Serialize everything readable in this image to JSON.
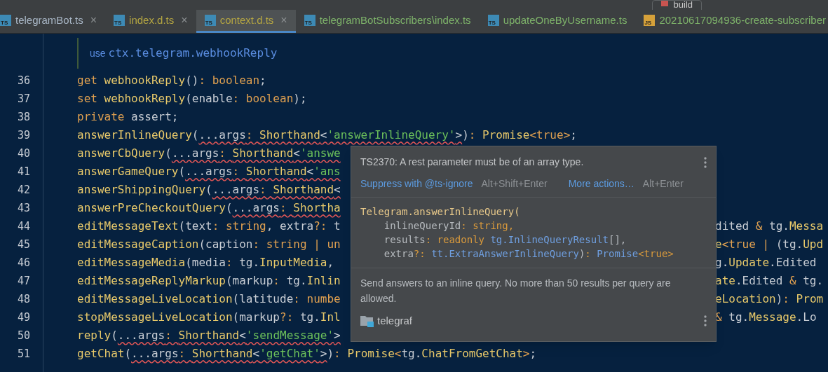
{
  "toolbar": {
    "run_config": "build"
  },
  "tabs": [
    {
      "icon_label": "TS",
      "label": "telegramBot.ts",
      "color": "#a9b7c6",
      "selected": false,
      "close": "×"
    },
    {
      "icon_label": "TS",
      "label": "index.d.ts",
      "color": "#b5a642",
      "selected": false,
      "close": "×"
    },
    {
      "icon_label": "TS",
      "label": "context.d.ts",
      "color": "#b5a642",
      "selected": true,
      "close": "×"
    },
    {
      "icon_label": "TS",
      "label": "telegramBotSubscribers\\index.ts",
      "color": "#7eb36a",
      "selected": false
    },
    {
      "icon_label": "TS",
      "label": "updateOneByUsername.ts",
      "color": "#7eb36a",
      "selected": false
    },
    {
      "icon_label": "JS",
      "label": "20210617094936-create-subscriber",
      "color": "#7eb36a",
      "selected": false
    }
  ],
  "doc_comment": {
    "prefix": "use",
    "code": "ctx.telegram.webhookReply"
  },
  "code_lines": [
    {
      "number": "36",
      "tokens": [
        {
          "text": "get ",
          "kind": "kw",
          "error": false
        },
        {
          "text": "webhookReply",
          "kind": "fn",
          "error": false
        },
        {
          "text": "()",
          "kind": "plain",
          "error": false
        },
        {
          "text": ": boolean",
          "kind": "kw",
          "error": false
        },
        {
          "text": ";",
          "kind": "plain",
          "error": false
        }
      ]
    },
    {
      "number": "37",
      "tokens": [
        {
          "text": "set ",
          "kind": "kw",
          "error": false
        },
        {
          "text": "webhookReply",
          "kind": "fn",
          "error": false
        },
        {
          "text": "(enable",
          "kind": "plain",
          "error": false
        },
        {
          "text": ": boolean",
          "kind": "kw",
          "error": false
        },
        {
          "text": ");",
          "kind": "plain",
          "error": false
        }
      ]
    },
    {
      "number": "38",
      "tokens": [
        {
          "text": "private ",
          "kind": "kw",
          "error": false
        },
        {
          "text": "assert;",
          "kind": "plain",
          "error": false
        }
      ]
    },
    {
      "number": "39",
      "tokens": [
        {
          "text": "answerInlineQuery",
          "kind": "fn",
          "error": false
        },
        {
          "text": "(",
          "kind": "plain",
          "error": false
        },
        {
          "text": "...args",
          "kind": "plain",
          "error": true
        },
        {
          "text": ": ",
          "kind": "kw",
          "error": true
        },
        {
          "text": "Shorthand",
          "kind": "type",
          "error": true
        },
        {
          "text": "<",
          "kind": "plain",
          "error": true
        },
        {
          "text": "'answerInlineQuery'",
          "kind": "str",
          "error": true
        },
        {
          "text": ">",
          "kind": "plain",
          "error": true
        },
        {
          "text": ")",
          "kind": "plain",
          "error": false
        },
        {
          "text": ": ",
          "kind": "kw",
          "error": false
        },
        {
          "text": "Promise",
          "kind": "type",
          "error": false
        },
        {
          "text": "<true>",
          "kind": "kw",
          "error": false
        },
        {
          "text": ";",
          "kind": "plain",
          "error": false
        }
      ]
    },
    {
      "number": "40",
      "tokens": [
        {
          "text": "answerCbQuery",
          "kind": "fn",
          "error": false
        },
        {
          "text": "(",
          "kind": "plain",
          "error": false
        },
        {
          "text": "...args",
          "kind": "plain",
          "error": true
        },
        {
          "text": ": ",
          "kind": "kw",
          "error": true
        },
        {
          "text": "Shorthand",
          "kind": "type",
          "error": true
        },
        {
          "text": "<",
          "kind": "plain",
          "error": true
        },
        {
          "text": "'answe",
          "kind": "str",
          "error": true
        }
      ]
    },
    {
      "number": "41",
      "tokens": [
        {
          "text": "answerGameQuery",
          "kind": "fn",
          "error": false
        },
        {
          "text": "(",
          "kind": "plain",
          "error": false
        },
        {
          "text": "...args",
          "kind": "plain",
          "error": true
        },
        {
          "text": ": ",
          "kind": "kw",
          "error": true
        },
        {
          "text": "Shorthand",
          "kind": "type",
          "error": true
        },
        {
          "text": "<",
          "kind": "plain",
          "error": true
        },
        {
          "text": "'ans",
          "kind": "str",
          "error": true
        }
      ]
    },
    {
      "number": "42",
      "tokens": [
        {
          "text": "answerShippingQuery",
          "kind": "fn",
          "error": false
        },
        {
          "text": "(",
          "kind": "plain",
          "error": false
        },
        {
          "text": "...args",
          "kind": "plain",
          "error": true
        },
        {
          "text": ": ",
          "kind": "kw",
          "error": true
        },
        {
          "text": "Shorthand",
          "kind": "type",
          "error": true
        },
        {
          "text": "<",
          "kind": "plain",
          "error": true
        }
      ]
    },
    {
      "number": "43",
      "tokens": [
        {
          "text": "answerPreCheckoutQuery",
          "kind": "fn",
          "error": false
        },
        {
          "text": "(",
          "kind": "plain",
          "error": false
        },
        {
          "text": "...args",
          "kind": "plain",
          "error": true
        },
        {
          "text": ": ",
          "kind": "kw",
          "error": true
        },
        {
          "text": "Shortha",
          "kind": "type",
          "error": true
        }
      ]
    },
    {
      "number": "44",
      "tokens": [
        {
          "text": "editMessageText",
          "kind": "fn",
          "error": false
        },
        {
          "text": "(text",
          "kind": "plain",
          "error": false
        },
        {
          "text": ": string",
          "kind": "kw",
          "error": false
        },
        {
          "text": ", extra",
          "kind": "plain",
          "error": false
        },
        {
          "text": "?: ",
          "kind": "kw",
          "error": false
        },
        {
          "text": "t",
          "kind": "plain",
          "error": false
        }
      ],
      "tail": [
        {
          "text": "dited ",
          "kind": "plain",
          "error": false
        },
        {
          "text": "& ",
          "kind": "kw",
          "error": false
        },
        {
          "text": "tg.",
          "kind": "plain",
          "error": false
        },
        {
          "text": "Messa",
          "kind": "type",
          "error": false
        }
      ]
    },
    {
      "number": "45",
      "tokens": [
        {
          "text": "editMessageCaption",
          "kind": "fn",
          "error": false
        },
        {
          "text": "(caption",
          "kind": "plain",
          "error": false
        },
        {
          "text": ": string | un",
          "kind": "kw",
          "error": false
        }
      ],
      "tail": [
        {
          "text": "e",
          "kind": "type",
          "error": false
        },
        {
          "text": "<true | ",
          "kind": "kw",
          "error": false
        },
        {
          "text": "(tg.",
          "kind": "plain",
          "error": false
        },
        {
          "text": "Upd",
          "kind": "type",
          "error": false
        }
      ]
    },
    {
      "number": "46",
      "tokens": [
        {
          "text": "editMessageMedia",
          "kind": "fn",
          "error": false
        },
        {
          "text": "(media",
          "kind": "plain",
          "error": false
        },
        {
          "text": ": ",
          "kind": "kw",
          "error": false
        },
        {
          "text": "tg.",
          "kind": "plain",
          "error": false
        },
        {
          "text": "InputMedia",
          "kind": "type",
          "error": false
        },
        {
          "text": ",",
          "kind": "plain",
          "error": false
        }
      ],
      "tail": [
        {
          "text": "g.",
          "kind": "plain",
          "error": false
        },
        {
          "text": "Update",
          "kind": "type",
          "error": false
        },
        {
          "text": ".Edited",
          "kind": "plain",
          "error": false
        }
      ]
    },
    {
      "number": "47",
      "tokens": [
        {
          "text": "editMessageReplyMarkup",
          "kind": "fn",
          "error": false
        },
        {
          "text": "(markup",
          "kind": "plain",
          "error": false
        },
        {
          "text": ": ",
          "kind": "kw",
          "error": false
        },
        {
          "text": "tg.",
          "kind": "plain",
          "error": false
        },
        {
          "text": "Inlin",
          "kind": "type",
          "error": false
        }
      ],
      "tail": [
        {
          "text": "ate",
          "kind": "type",
          "error": false
        },
        {
          "text": ".Edited ",
          "kind": "plain",
          "error": false
        },
        {
          "text": "& ",
          "kind": "kw",
          "error": false
        },
        {
          "text": "tg.",
          "kind": "plain",
          "error": false
        }
      ]
    },
    {
      "number": "48",
      "tokens": [
        {
          "text": "editMessageLiveLocation",
          "kind": "fn",
          "error": false
        },
        {
          "text": "(latitude",
          "kind": "plain",
          "error": false
        },
        {
          "text": ": numbe",
          "kind": "kw",
          "error": false
        }
      ],
      "tail": [
        {
          "text": "eLocation",
          "kind": "type",
          "error": false
        },
        {
          "text": ")",
          "kind": "plain",
          "error": false
        },
        {
          "text": ": ",
          "kind": "kw",
          "error": false
        },
        {
          "text": "Prom",
          "kind": "type",
          "error": false
        }
      ]
    },
    {
      "number": "49",
      "tokens": [
        {
          "text": "stopMessageLiveLocation",
          "kind": "fn",
          "error": false
        },
        {
          "text": "(markup",
          "kind": "plain",
          "error": false
        },
        {
          "text": "?: ",
          "kind": "kw",
          "error": false
        },
        {
          "text": "tg.",
          "kind": "plain",
          "error": false
        },
        {
          "text": "Inl",
          "kind": "type",
          "error": false
        }
      ],
      "tail": [
        {
          "text": "& ",
          "kind": "kw",
          "error": false
        },
        {
          "text": "tg.",
          "kind": "plain",
          "error": false
        },
        {
          "text": "Message",
          "kind": "type",
          "error": false
        },
        {
          "text": ".Lo",
          "kind": "plain",
          "error": false
        }
      ]
    },
    {
      "number": "50",
      "tokens": [
        {
          "text": "reply",
          "kind": "fn",
          "error": false
        },
        {
          "text": "(",
          "kind": "plain",
          "error": false
        },
        {
          "text": "...args",
          "kind": "plain",
          "error": true
        },
        {
          "text": ": ",
          "kind": "kw",
          "error": true
        },
        {
          "text": "Shorthand",
          "kind": "type",
          "error": true
        },
        {
          "text": "<",
          "kind": "plain",
          "error": true
        },
        {
          "text": "'sendMessage'",
          "kind": "str",
          "error": true
        },
        {
          "text": ">",
          "kind": "plain",
          "error": true
        }
      ]
    },
    {
      "number": "51",
      "tokens": [
        {
          "text": "getChat",
          "kind": "fn",
          "error": false
        },
        {
          "text": "(",
          "kind": "plain",
          "error": false
        },
        {
          "text": "...args",
          "kind": "plain",
          "error": true
        },
        {
          "text": ": ",
          "kind": "kw",
          "error": true
        },
        {
          "text": "Shorthand",
          "kind": "type",
          "error": true
        },
        {
          "text": "<",
          "kind": "plain",
          "error": true
        },
        {
          "text": "'getChat'",
          "kind": "str",
          "error": true
        },
        {
          "text": ">",
          "kind": "plain",
          "error": true
        },
        {
          "text": ")",
          "kind": "plain",
          "error": false
        },
        {
          "text": ": ",
          "kind": "kw",
          "error": false
        },
        {
          "text": "Promise",
          "kind": "type",
          "error": false
        },
        {
          "text": "<",
          "kind": "kw",
          "error": false
        },
        {
          "text": "tg.",
          "kind": "plain",
          "error": false
        },
        {
          "text": "ChatFromGetChat",
          "kind": "type",
          "error": false
        },
        {
          "text": ">",
          "kind": "kw",
          "error": false
        },
        {
          "text": ";",
          "kind": "plain",
          "error": false
        }
      ]
    }
  ],
  "popup": {
    "error": "TS2370: A rest parameter must be of an array type.",
    "actions": [
      {
        "label": "Suppress with @ts-ignore",
        "shortcut": "Alt+Shift+Enter"
      },
      {
        "label": "More actions…",
        "shortcut": "Alt+Enter"
      }
    ],
    "signature": [
      [
        {
          "text": "Telegram.answerInlineQuery(",
          "kind": "head"
        }
      ],
      [
        {
          "text": "    inlineQueryId",
          "kind": "plain"
        },
        {
          "text": ": string,",
          "kind": "kw"
        }
      ],
      [
        {
          "text": "    results",
          "kind": "plain"
        },
        {
          "text": ": readonly ",
          "kind": "kw"
        },
        {
          "text": "tg.InlineQueryResult",
          "kind": "ref"
        },
        {
          "text": "[],",
          "kind": "plain"
        }
      ],
      [
        {
          "text": "    extra",
          "kind": "plain"
        },
        {
          "text": "?: ",
          "kind": "kw"
        },
        {
          "text": "tt.ExtraAnswerInlineQuery",
          "kind": "ref"
        },
        {
          "text": ")",
          "kind": "plain"
        },
        {
          "text": ": ",
          "kind": "kw"
        },
        {
          "text": "Promise",
          "kind": "ref"
        },
        {
          "text": "<true>",
          "kind": "kw"
        }
      ]
    ],
    "description": "Send answers to an inline query. No more than 50 results per query are allowed.",
    "library": "telegraf"
  }
}
